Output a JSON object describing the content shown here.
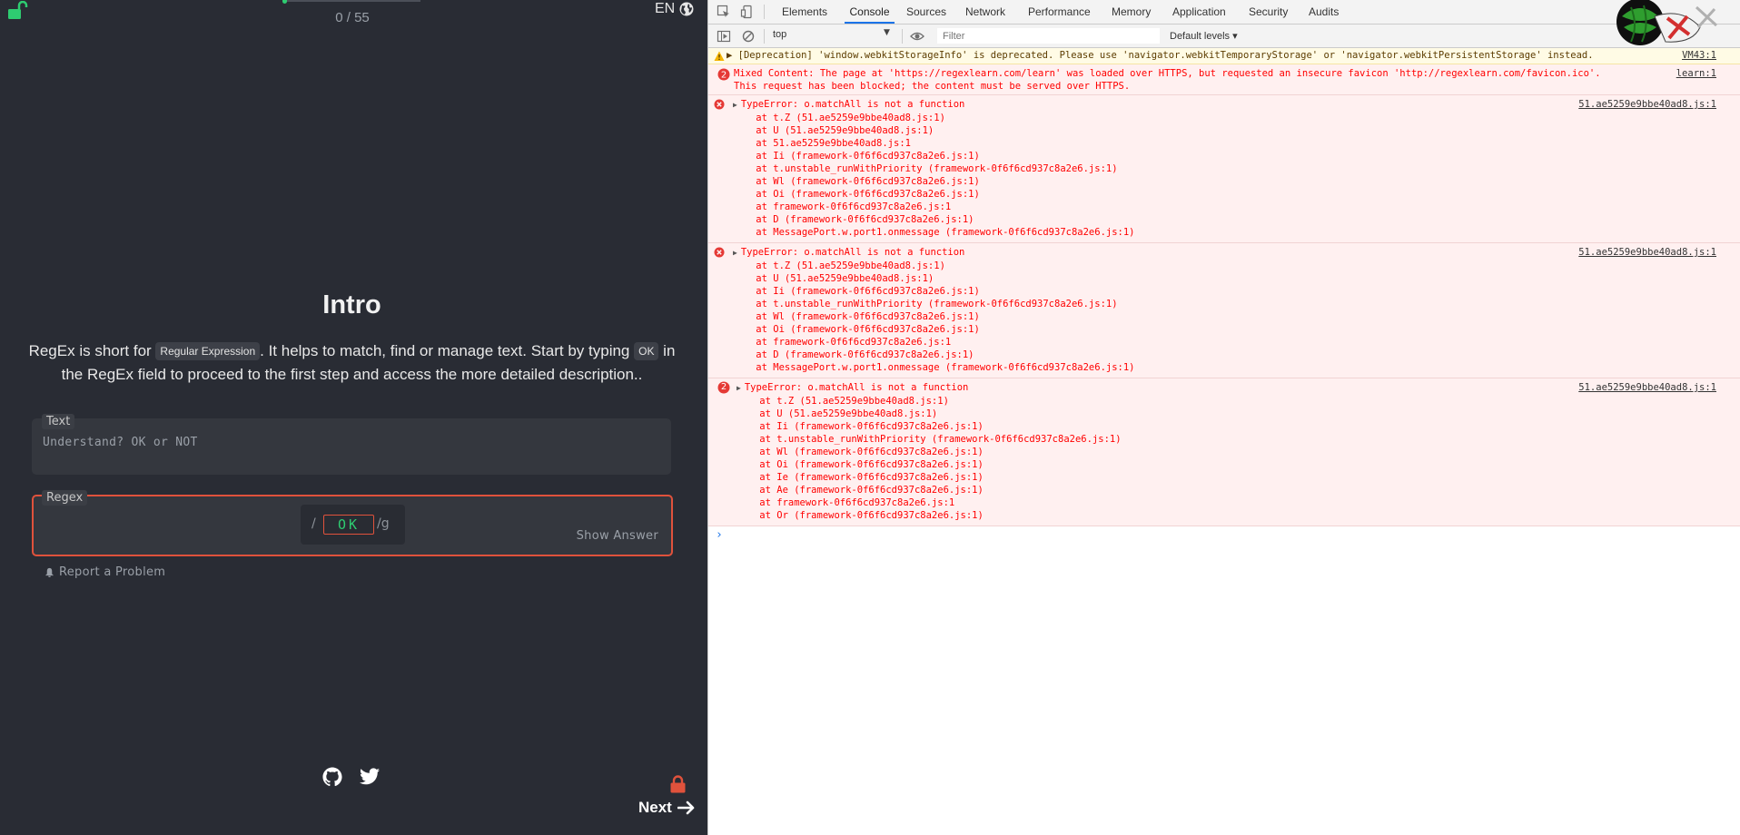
{
  "app": {
    "progress_text": "0 / 55",
    "progress_fraction": 0.0,
    "language": "EN",
    "title": "Intro",
    "description": {
      "part1": "RegEx is short for ",
      "pill1": "Regular Expression",
      "part2": ". It helps to match, find or manage text. Start by typing ",
      "pill2": "OK",
      "part3": " in the RegEx field to proceed to the first step and access the more detailed description.."
    },
    "text_label": "Text",
    "text_value": "Understand? OK or NOT",
    "regex_label": "Regex",
    "regex_open": "/",
    "regex_value": "OK",
    "regex_flags": "/g",
    "show_answer_label": "Show Answer",
    "report_label": "Report a Problem",
    "next_label": "Next",
    "colors": {
      "accent": "#2ecc71",
      "error": "#e0523c",
      "background": "#292c34"
    }
  },
  "devtools": {
    "tabs": [
      "Elements",
      "Console",
      "Sources",
      "Network",
      "Performance",
      "Memory",
      "Application",
      "Security",
      "Audits"
    ],
    "active_tab": "Console",
    "context": "top",
    "filter_placeholder": "Filter",
    "levels": "Default levels ▾",
    "warning": {
      "text": "▶ [Deprecation] 'window.webkitStorageInfo' is deprecated. Please use 'navigator.webkitTemporaryStorage' or 'navigator.webkitPersistentStorage' instead.",
      "source": "VM43:1"
    },
    "mixed": {
      "count": "2",
      "line1": "Mixed Content: The page at 'https://regexlearn.com/learn' was loaded over HTTPS, but requested an insecure favicon 'http://regexlearn.com/favicon.ico'.",
      "line2": "This request has been blocked; the content must be served over HTTPS.",
      "source": "learn:1"
    },
    "errors": [
      {
        "count": "",
        "title": "TypeError: o.matchAll is not a function",
        "source": "51.ae5259e9bbe40ad8.js:1",
        "frames": [
          "    at t.Z (51.ae5259e9bbe40ad8.js:1)",
          "    at U (51.ae5259e9bbe40ad8.js:1)",
          "    at 51.ae5259e9bbe40ad8.js:1",
          "    at Ii (framework-0f6f6cd937c8a2e6.js:1)",
          "    at t.unstable_runWithPriority (framework-0f6f6cd937c8a2e6.js:1)",
          "    at Wl (framework-0f6f6cd937c8a2e6.js:1)",
          "    at Oi (framework-0f6f6cd937c8a2e6.js:1)",
          "    at framework-0f6f6cd937c8a2e6.js:1",
          "    at D (framework-0f6f6cd937c8a2e6.js:1)",
          "    at MessagePort.w.port1.onmessage (framework-0f6f6cd937c8a2e6.js:1)"
        ]
      },
      {
        "count": "",
        "title": "TypeError: o.matchAll is not a function",
        "source": "51.ae5259e9bbe40ad8.js:1",
        "frames": [
          "    at t.Z (51.ae5259e9bbe40ad8.js:1)",
          "    at U (51.ae5259e9bbe40ad8.js:1)",
          "    at Ii (framework-0f6f6cd937c8a2e6.js:1)",
          "    at t.unstable_runWithPriority (framework-0f6f6cd937c8a2e6.js:1)",
          "    at Wl (framework-0f6f6cd937c8a2e6.js:1)",
          "    at Oi (framework-0f6f6cd937c8a2e6.js:1)",
          "    at framework-0f6f6cd937c8a2e6.js:1",
          "    at D (framework-0f6f6cd937c8a2e6.js:1)",
          "    at MessagePort.w.port1.onmessage (framework-0f6f6cd937c8a2e6.js:1)"
        ]
      },
      {
        "count": "2",
        "title": "TypeError: o.matchAll is not a function",
        "source": "51.ae5259e9bbe40ad8.js:1",
        "frames": [
          "    at t.Z (51.ae5259e9bbe40ad8.js:1)",
          "    at U (51.ae5259e9bbe40ad8.js:1)",
          "    at Ii (framework-0f6f6cd937c8a2e6.js:1)",
          "    at t.unstable_runWithPriority (framework-0f6f6cd937c8a2e6.js:1)",
          "    at Wl (framework-0f6f6cd937c8a2e6.js:1)",
          "    at Oi (framework-0f6f6cd937c8a2e6.js:1)",
          "    at Ie (framework-0f6f6cd937c8a2e6.js:1)",
          "    at Ae (framework-0f6f6cd937c8a2e6.js:1)",
          "    at framework-0f6f6cd937c8a2e6.js:1",
          "    at Or (framework-0f6f6cd937c8a2e6.js:1)"
        ]
      }
    ],
    "prompt": "›"
  }
}
